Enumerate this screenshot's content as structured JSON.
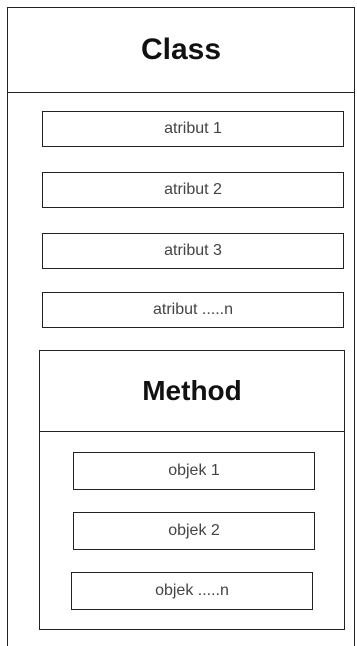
{
  "class": {
    "title": "Class",
    "attributes": [
      "atribut 1",
      "atribut 2",
      "atribut 3",
      "atribut .....n"
    ]
  },
  "method": {
    "title": "Method",
    "objects": [
      "objek 1",
      "objek 2",
      "objek .....n"
    ]
  }
}
